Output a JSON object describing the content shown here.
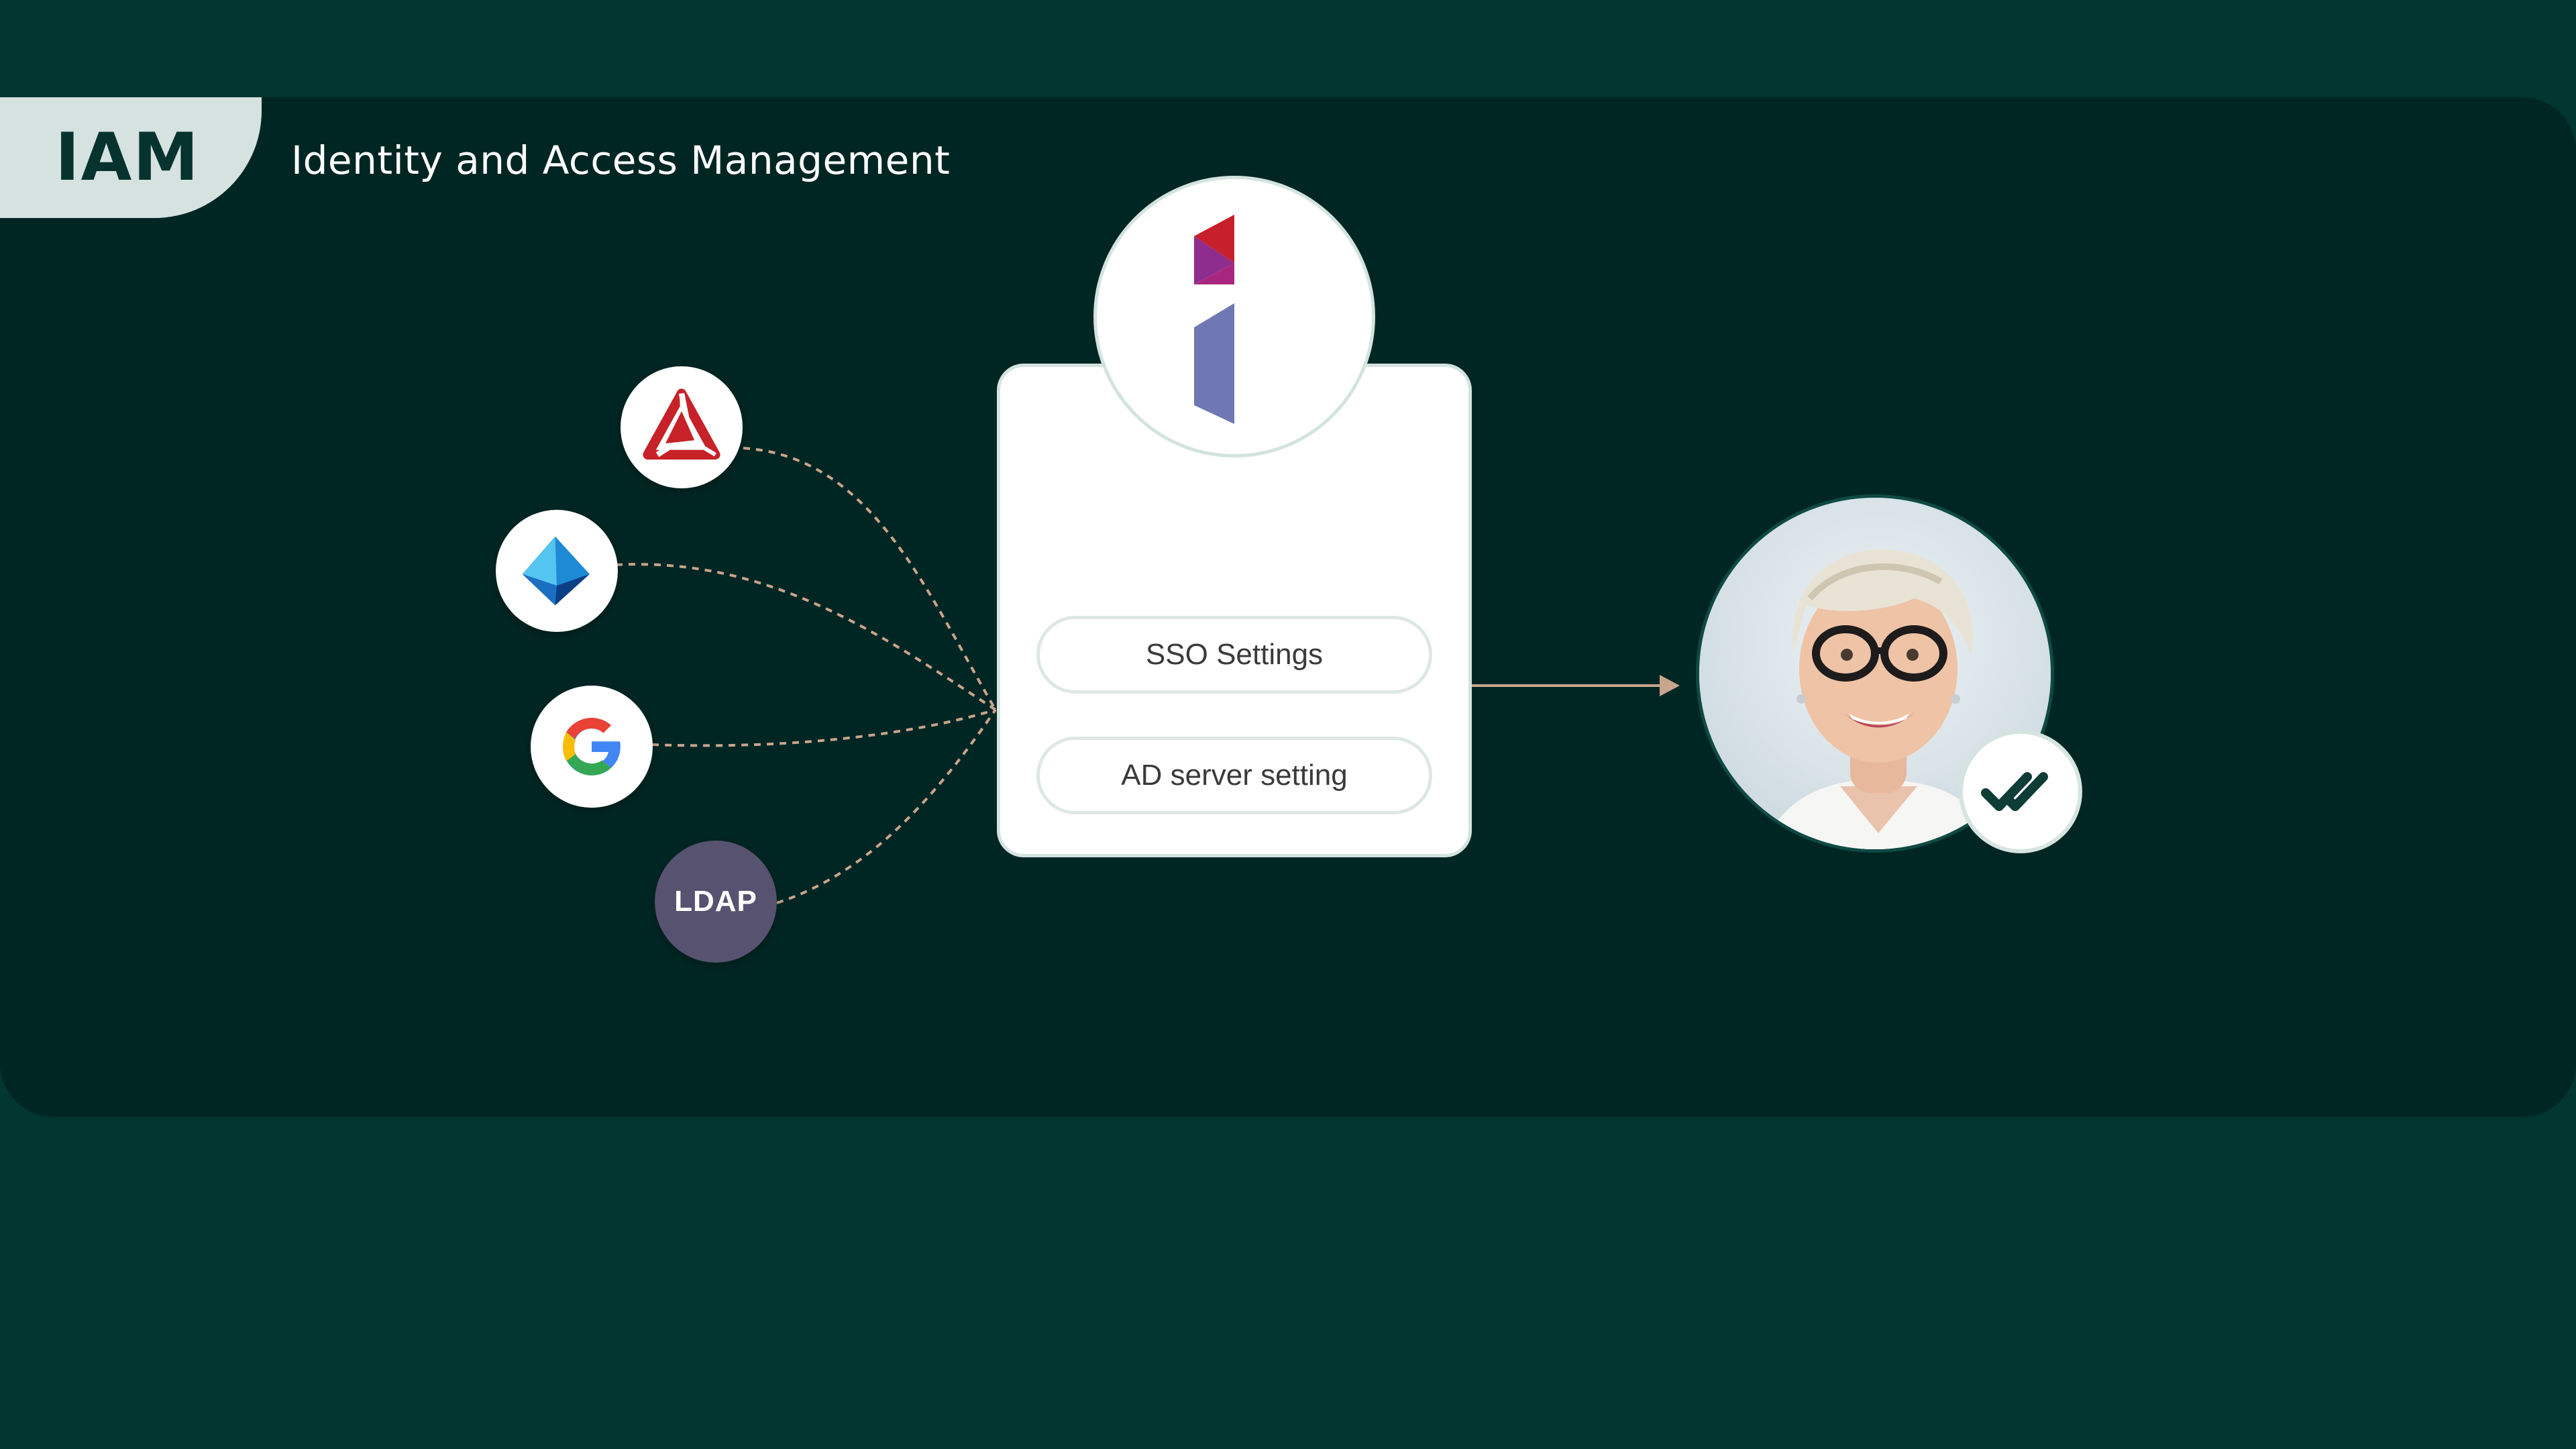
{
  "header": {
    "badge": "IAM",
    "subtitle": "Identity and Access Management"
  },
  "providers": [
    {
      "id": "red-triangle-logo",
      "label": ""
    },
    {
      "id": "azure-ad-logo",
      "label": ""
    },
    {
      "id": "google-logo",
      "label": ""
    },
    {
      "id": "ldap",
      "label": "LDAP"
    }
  ],
  "card": {
    "logo_icon": "brand-i-logo-icon",
    "buttons": [
      {
        "label": "SSO Settings"
      },
      {
        "label": "AD server setting"
      }
    ]
  },
  "user": {
    "avatar": "user-avatar",
    "badge_icon": "double-check-icon"
  },
  "colors": {
    "page_bg": "#023630",
    "panel_bg": "#002623",
    "tab_bg": "#d5e2df",
    "connector": "#c9a58d",
    "ldap_bg": "#56526f",
    "check": "#0d3d36"
  }
}
